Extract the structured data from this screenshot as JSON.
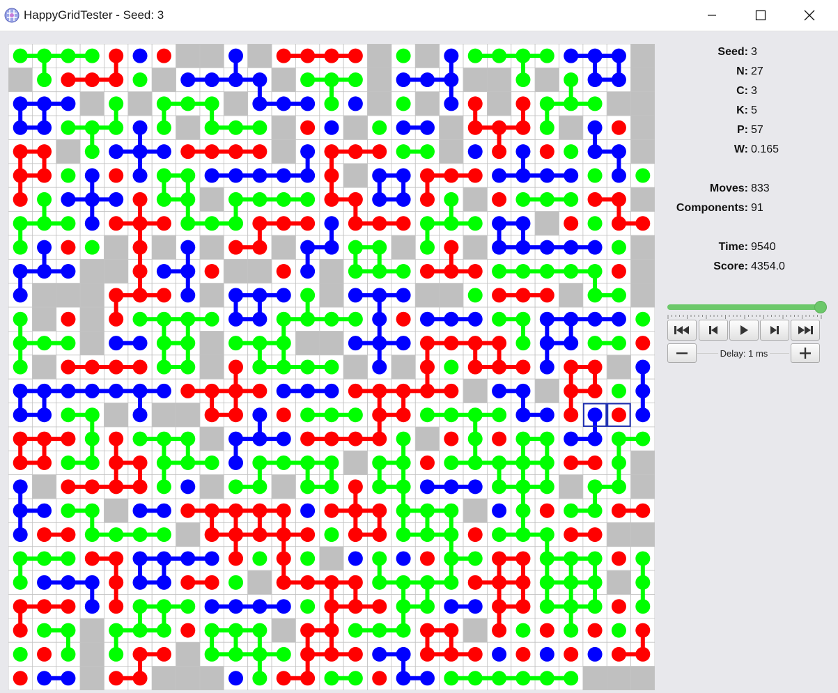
{
  "window": {
    "title": "HappyGridTester - Seed: 3",
    "icons": [
      "app-icon",
      "minimize-icon",
      "maximize-icon",
      "close-icon"
    ]
  },
  "info": {
    "params": [
      {
        "key": "Seed:",
        "value": "3"
      },
      {
        "key": "N:",
        "value": "27"
      },
      {
        "key": "C:",
        "value": "3"
      },
      {
        "key": "K:",
        "value": "5"
      },
      {
        "key": "P:",
        "value": "57"
      },
      {
        "key": "W:",
        "value": "0.165"
      }
    ],
    "stats": [
      {
        "key": "Moves:",
        "value": "833"
      },
      {
        "key": "Components:",
        "value": "91"
      }
    ],
    "result": [
      {
        "key": "Time:",
        "value": "9540"
      },
      {
        "key": "Score:",
        "value": "4354.0"
      }
    ]
  },
  "playback": {
    "slider_position": 1.0,
    "buttons": [
      "first-icon",
      "previous-icon",
      "play-icon",
      "next-icon",
      "last-icon"
    ],
    "delay_label": "Delay: 1 ms",
    "decrease_icon": "minus-icon",
    "increase_icon": "plus-icon"
  },
  "colors": {
    "red": "#ff0000",
    "green": "#00ff00",
    "blue": "#0000ff",
    "wall": "#c0c0c0",
    "cell": "#ffffff",
    "gridline": "#c4c4c4",
    "selection": "#1e2fb0",
    "slider": "#6cc86a"
  },
  "grid": {
    "size": 27,
    "legend": "0 empty/wall, R red, G green, B blue",
    "rows": [
      "GGGGRBR00B0RRRR0G0BGGGGBBB00",
      "0GRRRG0BBBB0GGG0BBB00G0GBB",
      "BBB0G0GGG0BBBGB0G0BR0RGGG0",
      "BBGGGBG0GGG0RB0GBB0RRRG0BR",
      "RR0GBBBRRRR0BRRRGG0BRBRGBB",
      "RRGBRBGGBBBBBR0BBRRRBBBBGBG",
      "RGBBBRGG0GGGGRRBBRG0RGGGRR",
      "GGGBRRRGGGRRRBRRRGGGBB0RGRR",
      "GBRG0R0B0RR0BBGG0GR0BBBBBG",
      "BBB00RBBR00RB0GGGRRRGGGGGR",
      "B000RRRB0BBBG0BBB00GRRR0GG0R",
      "G0R0RGGGGBBGGGGBRBBBGGBBBBGR",
      "GGG0BBGG0GGG00BBBRRRRGBBGGRB",
      "G0RRRRGG0RGGGG0B0RGRRRBRR0B0",
      "BBBBBBBRRRRBBBRRRRR0BB0RRGB",
      "BBGG0B00RRBRGGGRRGGGGBBRBRB",
      "RRRGRGGG0BBBRRRRG0RGRGGBBGG",
      "RRGGRRGGGBGGGG0GGRGGGGGRRG",
      "B0RRRRGB0GG0GGRGGBBBGGG0GG",
      "BBGG0BBRRRRRBRRRGGG0BGRGGRR",
      "BRRGGGG0RRRRRGRRGGGRGGGRR0",
      "GGGRRBBBBRGRG0BGBRGGRRGGGRG",
      "GBBBRBBRRG0RRRRGGGGRRRGGG0G",
      "RRRBRGGGBBBBGRRRGGBBRRGGGRGG",
      "RGG0GGGRGGG0RRGGGRR0RGRGRGRR",
      "GRG0GRR0GGGGRRRBBRRRBRBRBRRR",
      "RBB0RR000BGRRGGRBBGGGGGG0"
    ],
    "selection": {
      "row": 15,
      "cols": [
        24,
        25
      ]
    }
  }
}
